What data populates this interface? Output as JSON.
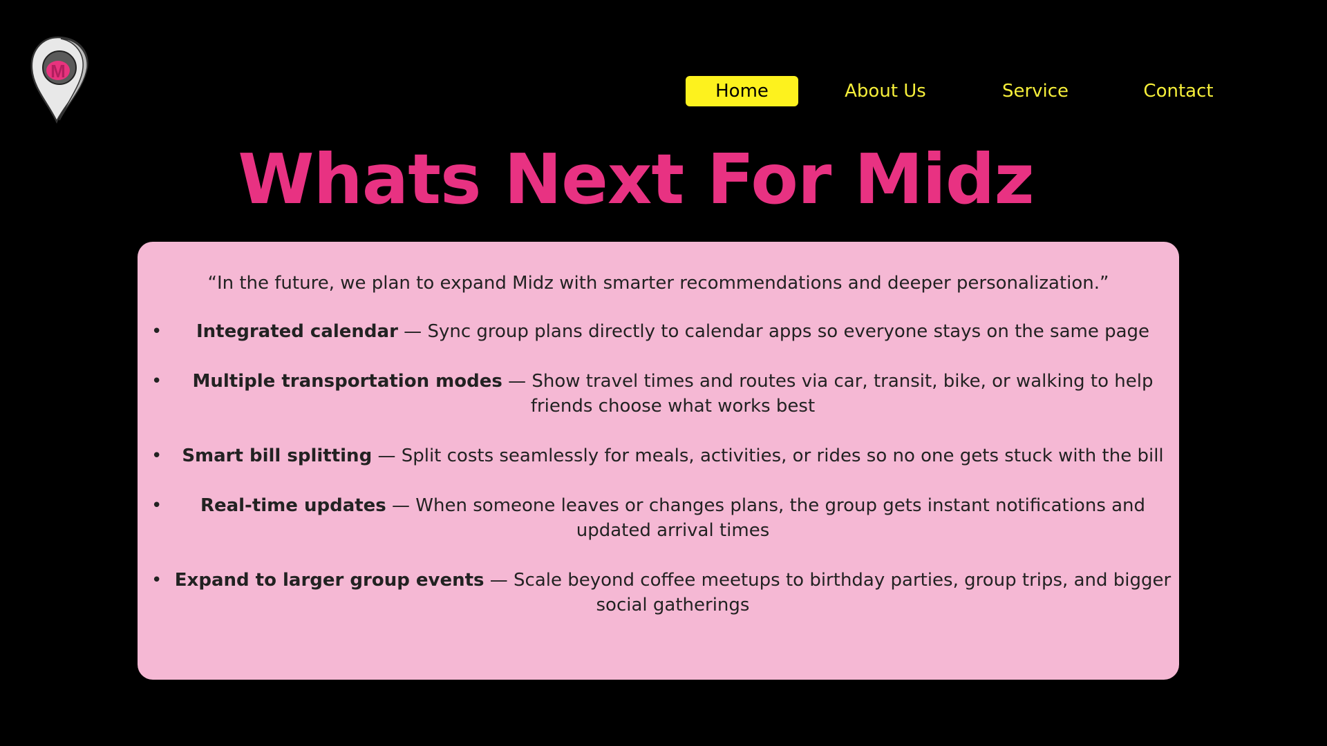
{
  "nav": {
    "items": [
      {
        "label": "Home",
        "active": true
      },
      {
        "label": "About Us",
        "active": false
      },
      {
        "label": "Service",
        "active": false
      },
      {
        "label": "Contact",
        "active": false
      }
    ]
  },
  "logo": {
    "icon": "map-pin-logo-icon",
    "letter": "M"
  },
  "hero": {
    "title": "Whats Next For Midz"
  },
  "card": {
    "quote": "“In the future, we plan to expand Midz with smarter recommendations and deeper personalization.”",
    "bullet_symbol": "•",
    "features": [
      {
        "title": "Integrated calendar",
        "description": " — Sync group plans directly to calendar apps so everyone stays on the same page"
      },
      {
        "title": "Multiple transportation modes",
        "description": " — Show travel times and routes via car, transit, bike, or walking to help friends choose what works best"
      },
      {
        "title": "Smart bill splitting",
        "description": " — Split costs seamlessly for meals, activities, or rides so no one gets stuck with the bill"
      },
      {
        "title": "Real-time updates",
        "description": " — When someone leaves or changes plans, the group gets instant notifications and updated arrival times"
      },
      {
        "title": "Expand to larger group events",
        "description": " — Scale beyond coffee meetups to birthday parties, group trips, and bigger social gatherings"
      }
    ]
  },
  "colors": {
    "background": "#000000",
    "title": "#e83282",
    "nav_text": "#f6ef3a",
    "nav_active_bg": "#fdf21e",
    "card_bg": "#f5b8d4",
    "card_text": "#222222"
  }
}
